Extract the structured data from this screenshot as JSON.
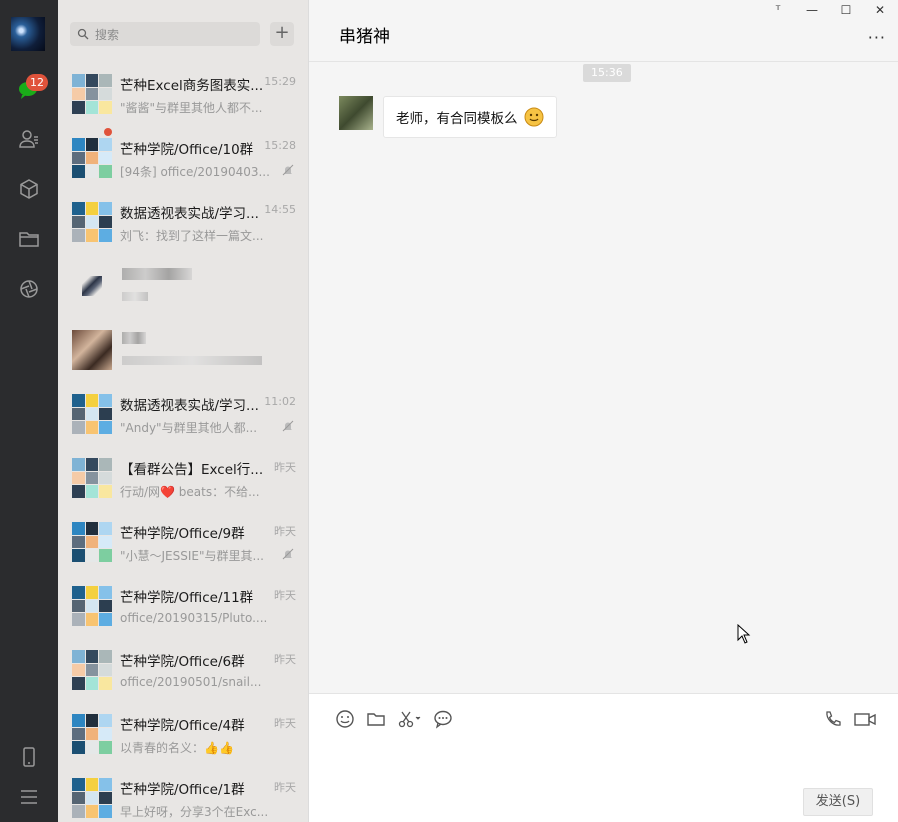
{
  "nav": {
    "unread_badge": "12",
    "icons": [
      "chat-icon",
      "contacts-icon",
      "favorites-icon",
      "files-icon",
      "moments-icon",
      "phone-icon",
      "menu-icon"
    ]
  },
  "search": {
    "placeholder": "搜索",
    "add_label": "+"
  },
  "sessions": [
    {
      "name": "芒种Excel商务图表实...",
      "time": "15:29",
      "preview": "\"酱酱\"与群里其他人都不...",
      "muted": false
    },
    {
      "name": "芒种学院/Office/10群",
      "time": "15:28",
      "preview": "[94条] office/20190403...",
      "muted": true,
      "unread_dot": true
    },
    {
      "name": "数据透视表实战/学习...",
      "time": "14:55",
      "preview": "刘飞：找到了这样一篇文...",
      "muted": false
    },
    {
      "name": "",
      "time": "",
      "preview": "",
      "muted": false,
      "blurred": true
    },
    {
      "name": "",
      "time": "",
      "preview": "",
      "muted": false,
      "blurred": true
    },
    {
      "name": "数据透视表实战/学习...",
      "time": "11:02",
      "preview": "\"Andy\"与群里其他人都...",
      "muted": true
    },
    {
      "name": "【看群公告】Excel行...",
      "time": "昨天",
      "preview": "行动/网❤️ beats：不给...",
      "muted": false
    },
    {
      "name": "芒种学院/Office/9群",
      "time": "昨天",
      "preview": "\"小慧～JESSIE\"与群里其...",
      "muted": true
    },
    {
      "name": "芒种学院/Office/11群",
      "time": "昨天",
      "preview": "office/20190315/Pluto....",
      "muted": false
    },
    {
      "name": "芒种学院/Office/6群",
      "time": "昨天",
      "preview": "office/20190501/snail...",
      "muted": false
    },
    {
      "name": "芒种学院/Office/4群",
      "time": "昨天",
      "preview": "以青春的名义：👍👍",
      "muted": false
    },
    {
      "name": "芒种学院/Office/1群",
      "time": "昨天",
      "preview": "早上好呀，分享3个在Exc...",
      "muted": false
    }
  ],
  "chat": {
    "title": "串猪神",
    "more_label": "···",
    "timestamp": "15:36",
    "messages": [
      {
        "text": "老师，有合同模板么"
      }
    ],
    "send_label": "发送(S)"
  },
  "window": {
    "pin": "ᵀ",
    "minimize": "—",
    "maximize": "☐",
    "close": "✕"
  },
  "colors": {
    "nav_bg": "#2b2c2e",
    "list_bg": "#e8e6e4",
    "chat_bg": "#f5f5f5",
    "badge": "#e0533b",
    "accent_green": "#1aad19"
  }
}
